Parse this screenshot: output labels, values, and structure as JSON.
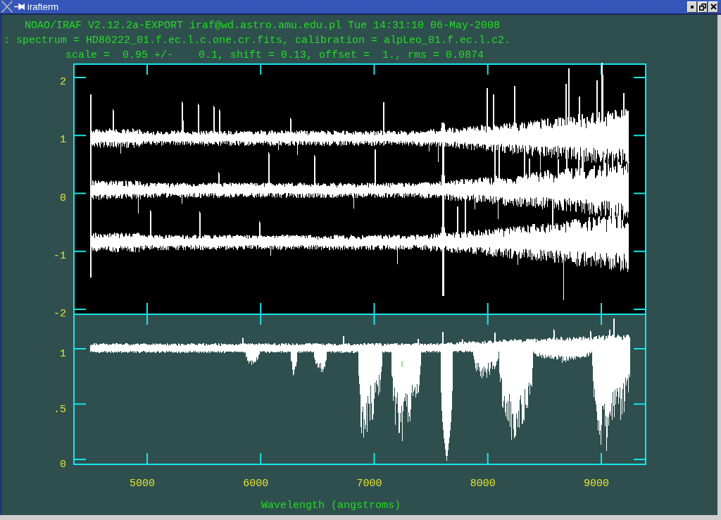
{
  "window": {
    "title": "irafterm"
  },
  "terminal": {
    "lines": [
      "NOAO/IRAF V2.12.2a-EXPORT iraf@wd.astro.amu.edu.pl Tue 14:31:10 06-May-2008",
      ": spectrum = HD86222_01.f.ec.l.c.one.cr.fits, calibration = alpLeo_01.f.ec.l.c2.",
      "scale =  0.95 +/-    0.1, shift = 0.13, offset =  1., rms = 0.0874"
    ]
  },
  "plot": {
    "top_panel": {
      "y_tick_labels": [
        "2",
        "1",
        "0",
        "-1",
        "-2"
      ]
    },
    "bottom_panel": {
      "y_tick_labels": [
        "1",
        ".5",
        "0"
      ]
    },
    "x_tick_labels": [
      "5000",
      "6000",
      "7000",
      "8000",
      "9000"
    ],
    "xlabel": "Wavelength (angstroms)"
  }
}
